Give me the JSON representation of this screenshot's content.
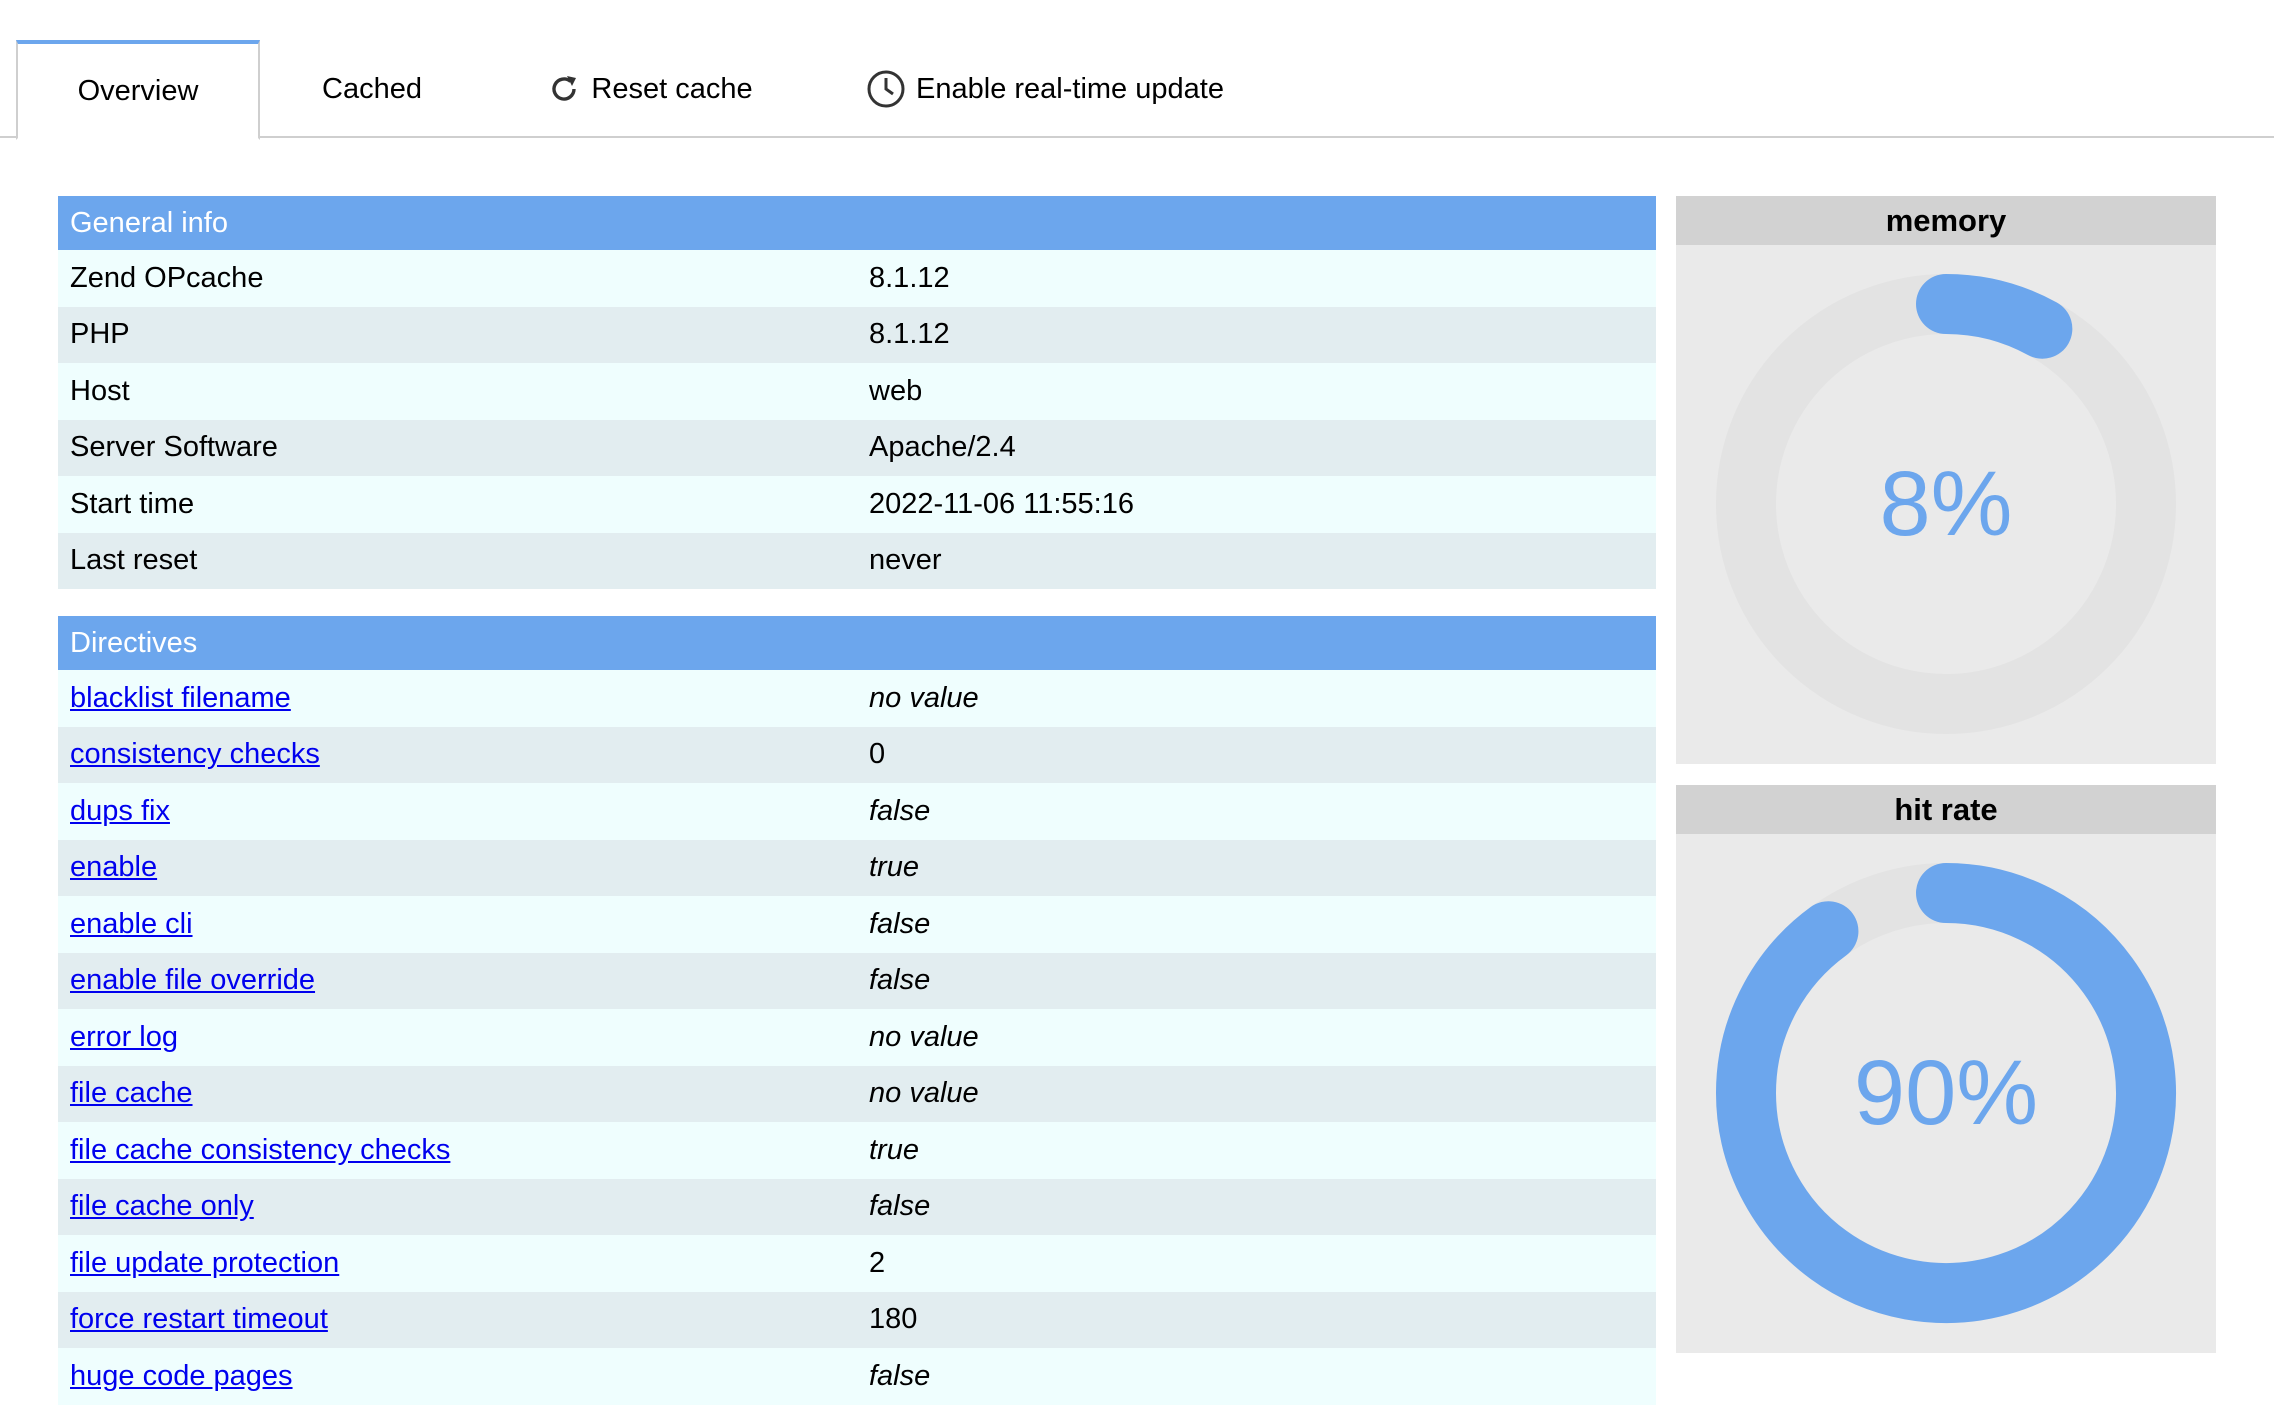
{
  "tabs": {
    "overview": "Overview",
    "cached": "Cached",
    "reset": "Reset cache",
    "realtime": "Enable real-time update"
  },
  "general": {
    "title": "General info",
    "rows": [
      {
        "key": "Zend OPcache",
        "value": "8.1.12"
      },
      {
        "key": "PHP",
        "value": "8.1.12"
      },
      {
        "key": "Host",
        "value": "web"
      },
      {
        "key": "Server Software",
        "value": "Apache/2.4"
      },
      {
        "key": "Start time",
        "value": "2022-11-06 11:55:16"
      },
      {
        "key": "Last reset",
        "value": "never"
      }
    ]
  },
  "directives": {
    "title": "Directives",
    "rows": [
      {
        "key": "blacklist filename",
        "value": "no value",
        "italic": true
      },
      {
        "key": "consistency checks",
        "value": "0",
        "italic": false
      },
      {
        "key": "dups fix",
        "value": "false",
        "italic": true
      },
      {
        "key": "enable",
        "value": "true",
        "italic": true
      },
      {
        "key": "enable cli",
        "value": "false",
        "italic": true
      },
      {
        "key": "enable file override",
        "value": "false",
        "italic": true
      },
      {
        "key": "error log",
        "value": "no value",
        "italic": true
      },
      {
        "key": "file cache",
        "value": "no value",
        "italic": true
      },
      {
        "key": "file cache consistency checks",
        "value": "true",
        "italic": true
      },
      {
        "key": "file cache only",
        "value": "false",
        "italic": true
      },
      {
        "key": "file update protection",
        "value": "2",
        "italic": false
      },
      {
        "key": "force restart timeout",
        "value": "180",
        "italic": false
      },
      {
        "key": "huge code pages",
        "value": "false",
        "italic": true
      }
    ]
  },
  "gauges": {
    "memory": {
      "title": "memory",
      "label": "8%",
      "fraction": 0.08
    },
    "hitrate": {
      "title": "hit rate",
      "label": "90%",
      "fraction": 0.9
    }
  },
  "colors": {
    "accent": "#6ca6ed",
    "track": "#e3e3e3"
  }
}
